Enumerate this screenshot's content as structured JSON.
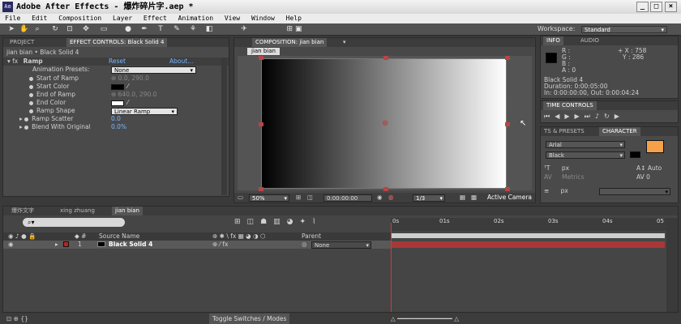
{
  "window": {
    "title": "Adobe After Effects - 爆炸碎片字.aep *",
    "logo": "Ae",
    "min": "_",
    "max": "□",
    "close": "×"
  },
  "menu": [
    "File",
    "Edit",
    "Composition",
    "Layer",
    "Effect",
    "Animation",
    "View",
    "Window",
    "Help"
  ],
  "toolbar": {
    "tools": [
      "selection-tool",
      "hand-tool",
      "zoom-tool",
      "rotate-tool",
      "camera-tool",
      "pan-behind-tool",
      "rectangle-tool",
      "pen-tool",
      "type-tool",
      "brush-tool",
      "clone-tool",
      "eraser-tool",
      "puppet-tool"
    ],
    "workspace_label": "Workspace:",
    "workspace_value": "Standard"
  },
  "effect_panel": {
    "tab_project": "PROJECT",
    "tab_effect": "EFFECT CONTROLS: Black Solid 4",
    "breadcrumb": "jian bian • Black Solid 4",
    "effect_name": "Ramp",
    "reset": "Reset",
    "about": "About...",
    "presets_label": "Animation Presets:",
    "presets_value": "None",
    "props": [
      {
        "label": "Start of Ramp",
        "value": "0.0, 290.0"
      },
      {
        "label": "Start Color",
        "value": ""
      },
      {
        "label": "End of Ramp",
        "value": "640.0, 290.0"
      },
      {
        "label": "End Color",
        "value": ""
      },
      {
        "label": "Ramp Shape",
        "value": "Linear Ramp"
      },
      {
        "label": "Ramp Scatter",
        "value": "0.0"
      },
      {
        "label": "Blend With Original",
        "value": "0.0%"
      }
    ]
  },
  "comp_panel": {
    "tab": "COMPOSITION: jian bian",
    "subtab": "jian bian",
    "zoom": "50%",
    "timecode": "0:00:00:00",
    "resolution": "1/3",
    "view": "Active Camera"
  },
  "info_panel": {
    "tab_info": "INFO",
    "tab_audio": "AUDIO",
    "r": "R :",
    "g": "G :",
    "b": "B :",
    "a": "A : 0",
    "x": "+ X : 758",
    "y": "Y : 286",
    "layer": "Black Solid 4",
    "duration": "Duration: 0:00:05:00",
    "inout": "In: 0:00:00:00, Out: 0:00:04:24"
  },
  "time_controls": {
    "tab": "TIME CONTROLS"
  },
  "character_panel": {
    "tab_presets": "TS & PRESETS",
    "tab_character": "CHARACTER",
    "font": "Arial",
    "style": "Black",
    "size_unit": "px",
    "leading": "Auto",
    "kerning": "Metrics",
    "tracking": "0",
    "stroke_unit": "px",
    "fill_color": "#f5a14a"
  },
  "timeline": {
    "tabs": [
      "爆炸文字",
      "xing zhuang",
      "jian bian"
    ],
    "search_placeholder": "",
    "col_source": "Source Name",
    "col_parent": "Parent",
    "layer": {
      "num": "1",
      "name": "Black Solid 4",
      "parent": "None"
    },
    "ruler": [
      "0s",
      "01s",
      "02s",
      "03s",
      "04s",
      "05"
    ],
    "toggle": "Toggle Switches / Modes"
  }
}
